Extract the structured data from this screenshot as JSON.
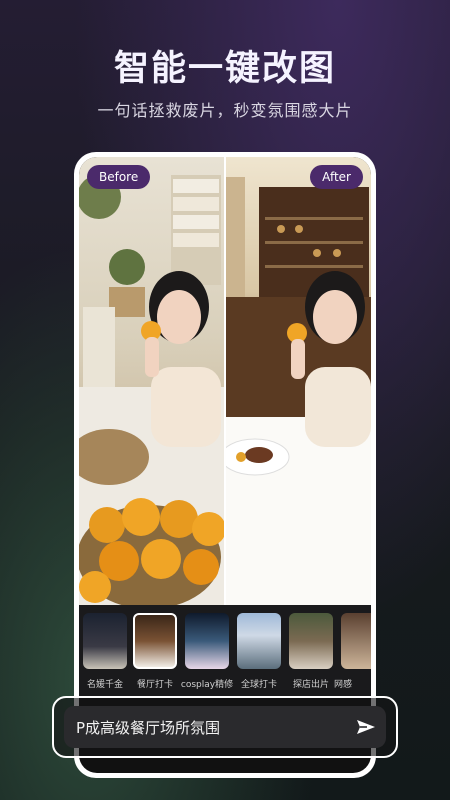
{
  "header": {
    "title": "智能一键改图",
    "subtitle": "一句话拯救废片，秒变氛围感大片"
  },
  "compare": {
    "before_label": "Before",
    "after_label": "After"
  },
  "styles": [
    {
      "label": "名媛千金",
      "selected": false
    },
    {
      "label": "餐厅打卡",
      "selected": true
    },
    {
      "label": "cosplay精修",
      "selected": false
    },
    {
      "label": "全球打卡",
      "selected": false
    },
    {
      "label": "探店出片",
      "selected": false
    },
    {
      "label": "网感",
      "selected": false
    }
  ],
  "prompt": {
    "text": "P成高级餐厅场所氛围"
  },
  "icons": {
    "send": "send-icon"
  }
}
